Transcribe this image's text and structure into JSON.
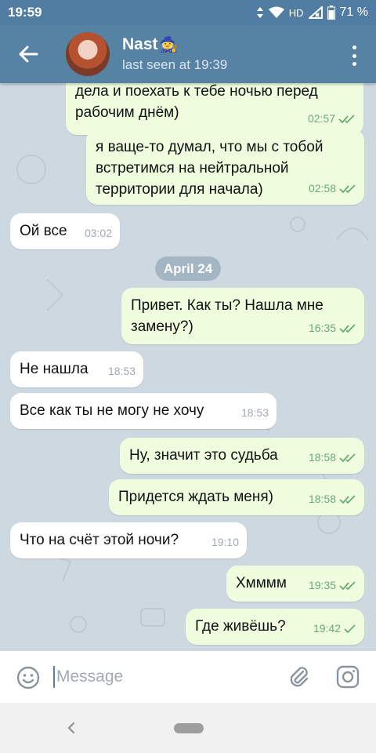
{
  "status_bar": {
    "time": "19:59",
    "network": "HD",
    "battery": "71 %"
  },
  "header": {
    "contact_name": "Nast",
    "contact_emoji": "🧙",
    "last_seen": "last seen at 19:39",
    "icons": {
      "back": "arrow-left-icon",
      "menu": "more-vertical-icon"
    }
  },
  "date_separator": "April 24",
  "messages": [
    {
      "direction": "out",
      "text": "дела и поехать к тебе ночью перед\nрабочим днём)",
      "time": "02:57",
      "status": "read"
    },
    {
      "direction": "out",
      "text": "я ваще-то думал, что мы с тобой\nвстретимся на нейтральной\nтерритории для начала)",
      "time": "02:58",
      "status": "read"
    },
    {
      "direction": "in",
      "text": "Ой все",
      "time": "03:02"
    },
    {
      "direction": "out",
      "text": "Привет. Как ты? Нашла мне\nзамену?)",
      "time": "16:35",
      "status": "read"
    },
    {
      "direction": "in",
      "text": "Не нашла",
      "time": "18:53"
    },
    {
      "direction": "in",
      "text": "Все как ты не могу не хочу",
      "time": "18:53"
    },
    {
      "direction": "out",
      "text": "Ну, значит это судьба",
      "time": "18:58",
      "status": "read"
    },
    {
      "direction": "out",
      "text": "Придется ждать меня)",
      "time": "18:58",
      "status": "read"
    },
    {
      "direction": "in",
      "text": "Что на счёт этой ночи?",
      "time": "19:10"
    },
    {
      "direction": "out",
      "text": "Хмммм",
      "time": "19:35",
      "status": "read"
    },
    {
      "direction": "out",
      "text": "Где живёшь?",
      "time": "19:42",
      "status": "sent"
    }
  ],
  "input": {
    "placeholder": "Message",
    "value": ""
  },
  "colors": {
    "header": "#5682a3",
    "outgoing": "#effdde",
    "incoming": "#ffffff",
    "check": "#6aab73"
  }
}
